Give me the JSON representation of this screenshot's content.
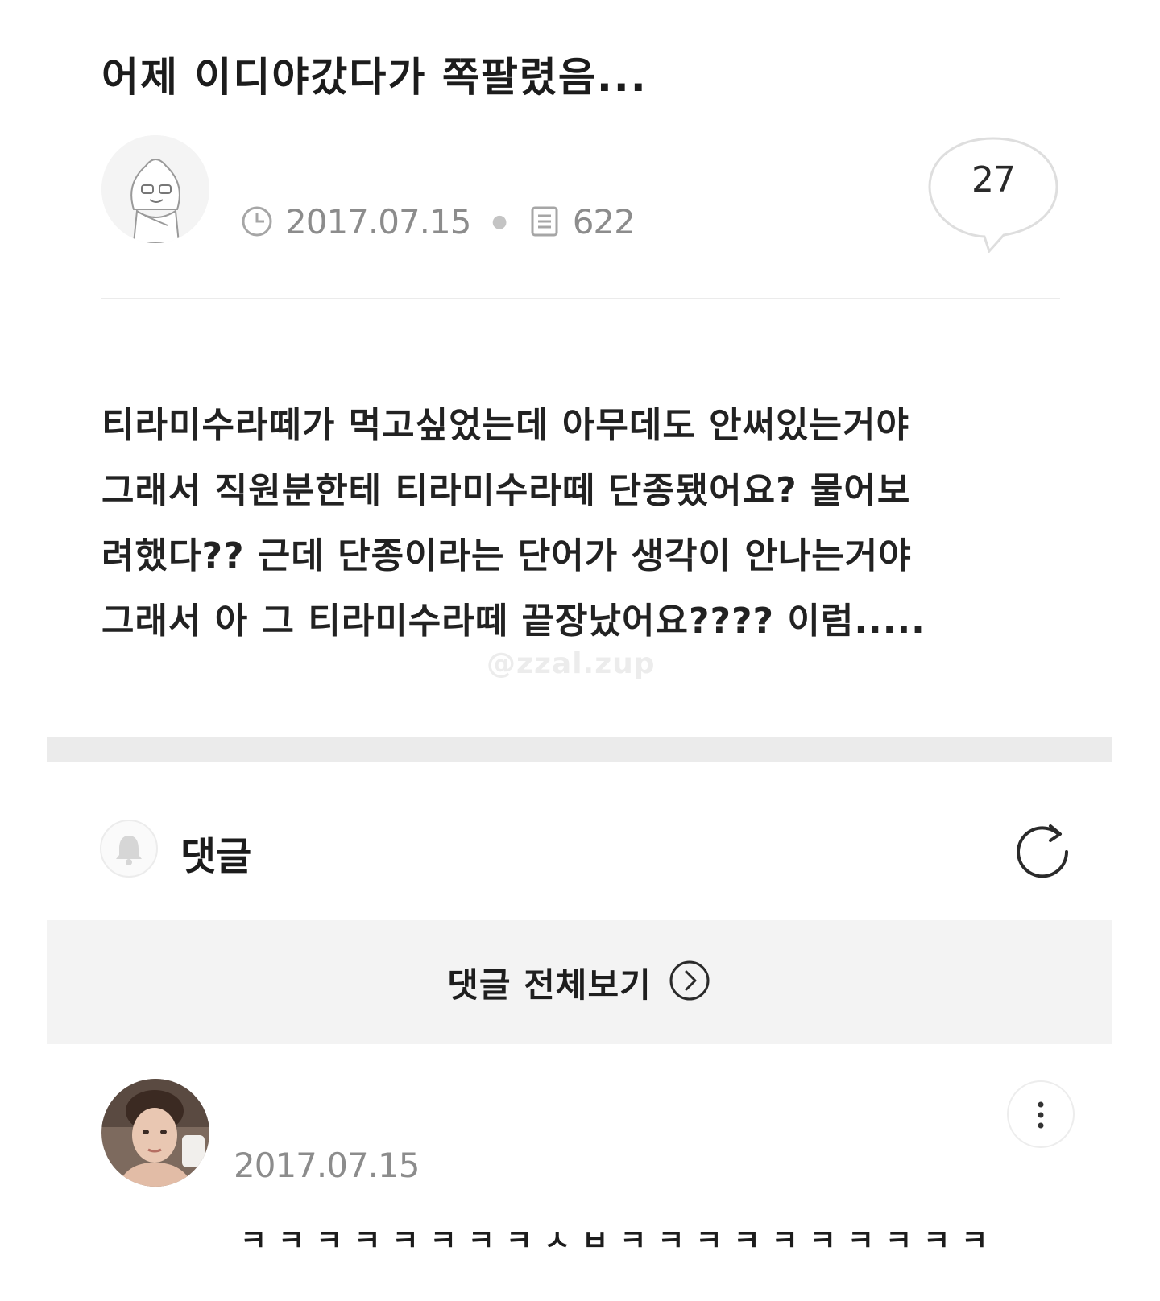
{
  "post": {
    "title": "어제 이디야갔다가 쪽팔렸음...",
    "date": "2017.07.15",
    "views": "622",
    "comment_count": "27",
    "body_lines": [
      "티라미수라떼가 먹고싶었는데 아무데도 안써있는거야",
      "그래서 직원분한테 티라미수라떼 단종됐어요? 물어보",
      "려했다?? 근데 단종이라는 단어가 생각이 안나는거야",
      "그래서 아 그 티라미수라떼 끝장났어요???? 이럼....."
    ]
  },
  "watermark": "@zzal.zup",
  "comments": {
    "label": "댓글",
    "view_all_label": "댓글 전체보기",
    "items": [
      {
        "date": "2017.07.15",
        "text": "ㅋㅋㅋㅋㅋㅋㅋㅋㅅㅂㅋㅋㅋㅋㅋㅋㅋㅋㅋㅋ"
      }
    ]
  },
  "icons": {
    "date": "clock-icon",
    "views": "document-icon",
    "comments_bubble": "speech-bubble-icon",
    "notify": "bell-icon",
    "refresh": "refresh-icon",
    "view_all": "chevron-right-circle-icon",
    "more": "more-vertical-icon"
  }
}
